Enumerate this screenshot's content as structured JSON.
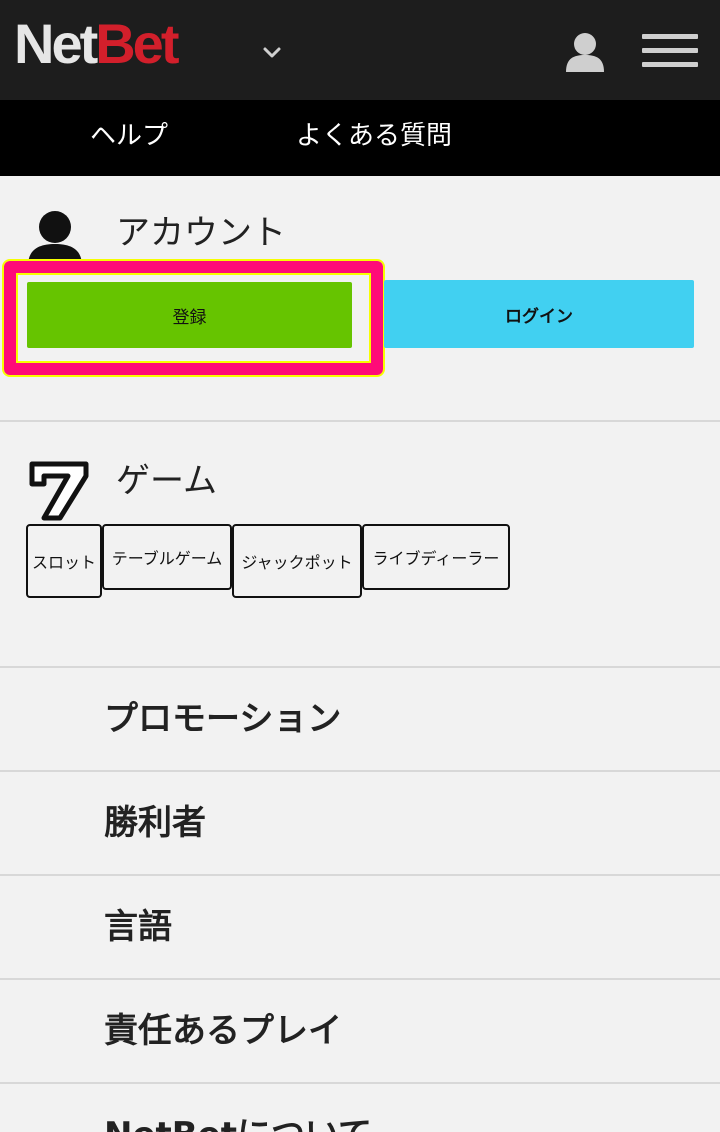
{
  "header": {
    "logo_net": "Net",
    "logo_bet": "Bet"
  },
  "subnav": {
    "help": "ヘルプ",
    "faq": "よくある質問"
  },
  "account": {
    "title": "アカウント",
    "register_label": "登録",
    "login_label": "ログイン"
  },
  "games": {
    "title": "ゲーム",
    "categories": [
      "スロット",
      "テーブルゲーム",
      "ジャックポット",
      "ライブディーラー"
    ]
  },
  "menu": {
    "items": [
      "プロモーション",
      "勝利者",
      "言語",
      "責任あるプレイ",
      "NetBetについて"
    ]
  },
  "colors": {
    "header_bg": "#1d1d1d",
    "brand_red": "#d21f2b",
    "register_green": "#66c400",
    "login_cyan": "#41d0f1",
    "highlight_pink": "#ff0b78",
    "highlight_yellow": "#f6ff00"
  }
}
